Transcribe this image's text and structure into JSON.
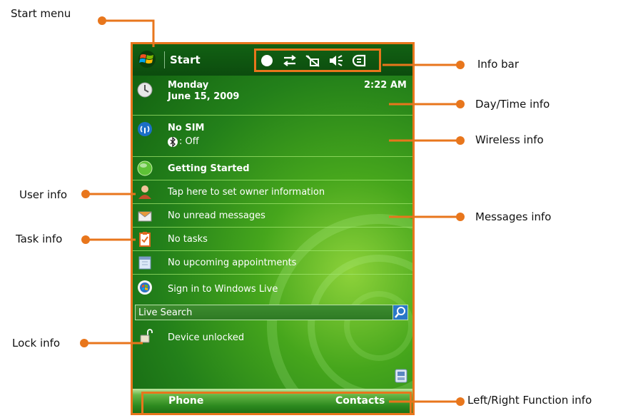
{
  "annotations": {
    "start_menu": "Start menu",
    "info_bar": "Info bar",
    "day_time": "Day/Time info",
    "wireless": "Wireless info",
    "user": "User info",
    "messages": "Messages info",
    "task": "Task info",
    "lock": "Lock info",
    "function": "Left/Right Function info"
  },
  "device": {
    "title": "Start",
    "status_icons": [
      "record-icon",
      "sync-arrows-icon",
      "no-signal-icon",
      "speaker-muted-icon",
      "battery-icon"
    ],
    "day": "Monday",
    "date": "June 15, 2009",
    "time": "2:22 AM",
    "wireless_title": "No SIM",
    "bluetooth_status": ": Off",
    "getting_started": "Getting Started",
    "owner": "Tap here to set owner information",
    "messages": "No unread messages",
    "tasks": "No tasks",
    "appointments": "No upcoming appointments",
    "live": "Sign in to Windows Live",
    "search_placeholder": "Live Search",
    "lock": "Device unlocked",
    "soft_left": "Phone",
    "soft_right": "Contacts"
  },
  "colors": {
    "accent": "#e8761c",
    "screen_green": "#23801a",
    "title_green": "#0c4c0e"
  }
}
